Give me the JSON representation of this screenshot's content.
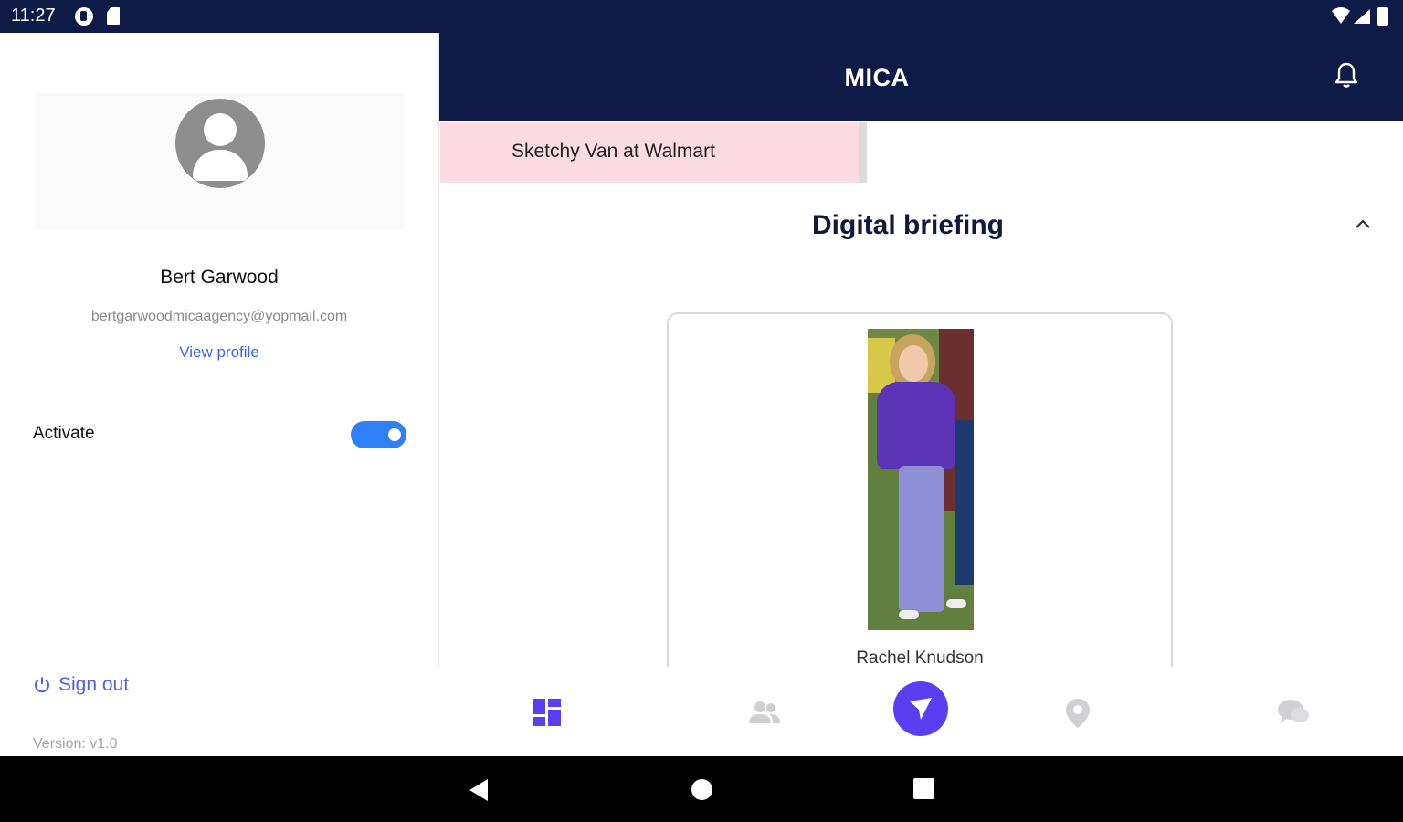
{
  "status_bar": {
    "time": "11:27"
  },
  "header": {
    "title": "MICA"
  },
  "drawer": {
    "user_name": "Bert Garwood",
    "user_email": "bertgarwoodmicaagency@yopmail.com",
    "view_profile": "View profile",
    "activate_label": "Activate",
    "activate_on": true,
    "sign_out": "Sign out",
    "version": "Version: v1.0"
  },
  "alert": {
    "text": "Sketchy Van at Walmart"
  },
  "briefing": {
    "title": "Digital briefing",
    "card": {
      "person_name": "Rachel Knudson"
    }
  },
  "bottom_nav": {
    "items": [
      "dashboard-icon",
      "people-icon",
      "send-icon",
      "location-icon",
      "chat-icon"
    ],
    "active": "dashboard-icon"
  },
  "colors": {
    "header_bg": "#0e1b46",
    "accent_purple": "#5b3df2",
    "toggle_blue": "#2f80f6",
    "alert_pink": "#fcdbe2",
    "link_blue": "#3a64e3"
  }
}
